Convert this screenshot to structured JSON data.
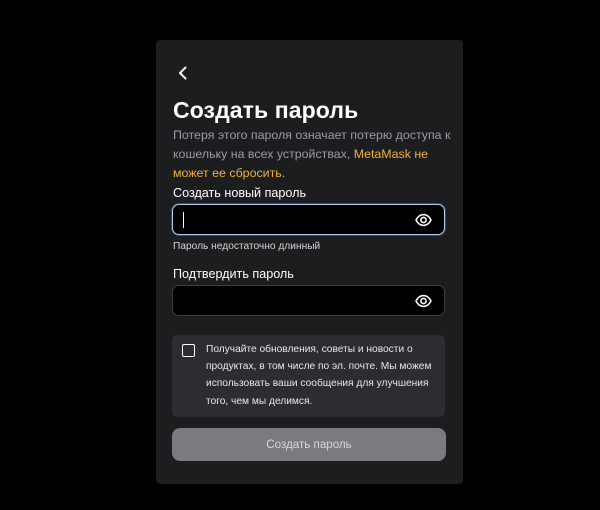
{
  "page": {
    "title": "Создать пароль",
    "description_prefix": "Потеря этого пароля означает потерю доступа к кошельку на всех устройствах, ",
    "description_warning": "MetaMask не может ее сбросить."
  },
  "icons": {
    "back": "arrow-left-icon",
    "show_password": "eye-icon"
  },
  "new_password": {
    "label": "Создать новый пароль",
    "value": "",
    "placeholder": "",
    "hint": "Пароль недостаточно длинный"
  },
  "confirm_password": {
    "label": "Подтвердить пароль",
    "value": "",
    "placeholder": ""
  },
  "consent": {
    "checked": false,
    "text": "Получайте обновления, советы и новости о продуктах, в том числе по эл. почте. Мы можем использовать ваши сообщения для улучшения того, чем мы делимся."
  },
  "submit": {
    "label": "Создать пароль",
    "enabled": false
  },
  "colors": {
    "background": "#000000",
    "card": "#1c1d1f",
    "warning_text": "#f0b034",
    "focus_border": "#b4c8f5",
    "button_disabled": "#7a7b7f"
  }
}
